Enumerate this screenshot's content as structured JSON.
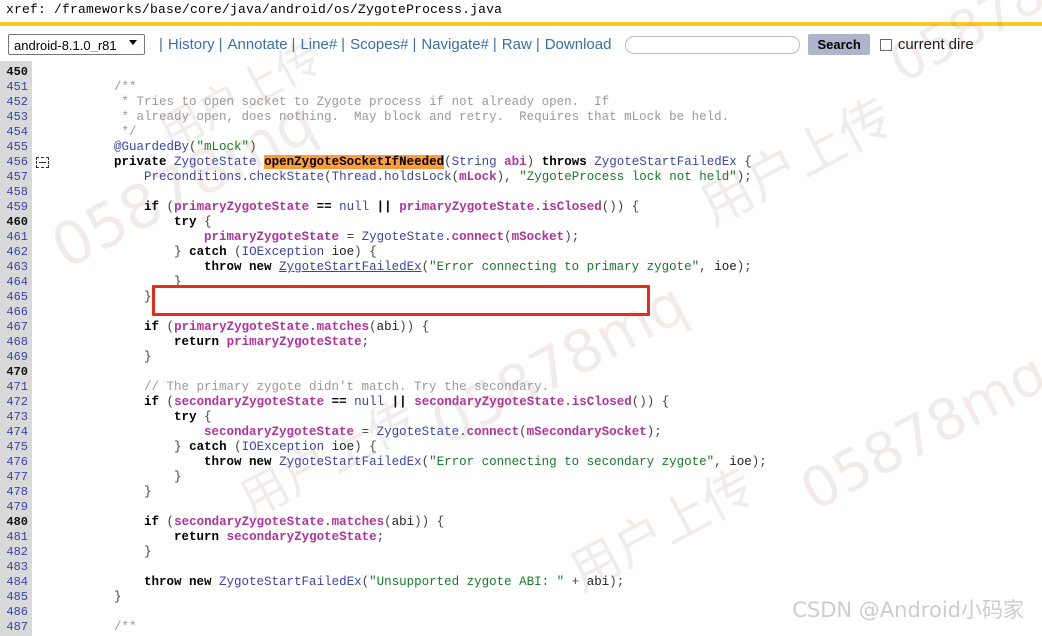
{
  "header": {
    "label": "xref:",
    "path": "/frameworks/base/core/java/android/os/ZygoteProcess.java",
    "full": "xref: /frameworks/base/core/java/android/os/ZygoteProcess.java",
    "accent_color": "#ffc627"
  },
  "toolbar": {
    "version_selected": "android-8.1.0_r81",
    "version_options": [
      "android-8.1.0_r81"
    ],
    "separator": "|",
    "links": [
      {
        "label": "History",
        "name": "history"
      },
      {
        "label": "Annotate",
        "name": "annotate"
      },
      {
        "label": "Line#",
        "name": "line-number"
      },
      {
        "label": "Scopes#",
        "name": "scopes"
      },
      {
        "label": "Navigate#",
        "name": "navigate"
      },
      {
        "label": "Raw",
        "name": "raw"
      },
      {
        "label": "Download",
        "name": "download"
      }
    ],
    "search_value": "",
    "search_placeholder": "",
    "search_button_label": "Search",
    "current_directory_label": "current dire",
    "current_directory_checked": false,
    "link_color": "#3b6ea8",
    "search_button_bg": "#aeb4cc"
  },
  "code": {
    "first_line": 450,
    "last_line": 487,
    "gutter_bg": "#d9d9d9",
    "fold_marker_line": 456,
    "lines": [
      {
        "n": 450,
        "html": ""
      },
      {
        "n": 451,
        "html": "        <span class='cmt'>/**</span>"
      },
      {
        "n": 452,
        "html": "         <span class='cmt'>* Tries to open socket to Zygote process if not already open.  If</span>"
      },
      {
        "n": 453,
        "html": "         <span class='cmt'>* already open, does nothing.  May block and retry.  Requires that mLock be held.</span>"
      },
      {
        "n": 454,
        "html": "         <span class='cmt'>*/</span>"
      },
      {
        "n": 455,
        "html": "        <span class='annot'>@GuardedBy</span><span class='punct'>(</span><span class='str'>\"mLock\"</span><span class='punct'>)</span>"
      },
      {
        "n": 456,
        "html": "        <span class='kw'>private</span> <span class='typ'>ZygoteState</span> <span class='hl'>openZygoteSocketIfNeeded</span><span class='punct'>(</span><span class='typ'>String</span> <span class='var'>abi</span><span class='punct'>)</span> <span class='kw'>throws</span> <span class='typ'>ZygoteStartFailedEx</span> <span class='punct'>{</span>"
      },
      {
        "n": 457,
        "html": "            <span class='typ'>Preconditions</span><span class='punct'>.</span><span class='typ'>checkState</span><span class='punct'>(</span><span class='typ'>Thread</span><span class='punct'>.</span><span class='typ'>holdsLock</span><span class='punct'>(</span><span class='var'>mLock</span><span class='punct'>),</span> <span class='str'>\"ZygoteProcess lock not held\"</span><span class='punct'>);</span>"
      },
      {
        "n": 458,
        "html": ""
      },
      {
        "n": 459,
        "html": "            <span class='kw'>if</span> <span class='punct'>(</span><span class='var'>primaryZygoteState</span> <span class='kw'>==</span> <span class='num'>null</span> <span class='kw'>||</span> <span class='var'>primaryZygoteState</span><span class='punct'>.</span><span class='var'>isClosed</span><span class='punct'>())</span> <span class='punct'>{</span>"
      },
      {
        "n": 460,
        "html": "                <span class='kw'>try</span> <span class='punct'>{</span>"
      },
      {
        "n": 461,
        "html": "                    <span class='var'>primaryZygoteState</span> <span class='punct'>=</span> <span class='typ'>ZygoteState</span><span class='punct'>.</span><span class='mth'>connect</span><span class='punct'>(</span><span class='var'>mSocket</span><span class='punct'>);</span>"
      },
      {
        "n": 462,
        "html": "                <span class='punct'>}</span> <span class='kw'>catch</span> <span class='punct'>(</span><span class='typ'>IOException</span> <span class='plain'>ioe</span><span class='punct'>)</span> <span class='punct'>{</span>"
      },
      {
        "n": 463,
        "html": "                    <span class='kw'>throw new</span> <span class='typu'>ZygoteStartFailedEx</span><span class='punct'>(</span><span class='str'>\"Error connecting to primary zygote\"</span><span class='punct'>,</span> <span class='plain'>ioe</span><span class='punct'>);</span>"
      },
      {
        "n": 464,
        "html": "                <span class='punct'>}</span>"
      },
      {
        "n": 465,
        "html": "            <span class='punct'>}</span>"
      },
      {
        "n": 466,
        "html": ""
      },
      {
        "n": 467,
        "html": "            <span class='kw'>if</span> <span class='punct'>(</span><span class='var'>primaryZygoteState</span><span class='punct'>.</span><span class='mth'>matches</span><span class='punct'>(</span><span class='plain'>abi</span><span class='punct'>))</span> <span class='punct'>{</span>"
      },
      {
        "n": 468,
        "html": "                <span class='kw'>return</span> <span class='var'>primaryZygoteState</span><span class='punct'>;</span>"
      },
      {
        "n": 469,
        "html": "            <span class='punct'>}</span>"
      },
      {
        "n": 470,
        "html": ""
      },
      {
        "n": 471,
        "html": "            <span class='cmt'>// The primary zygote didn't match. Try the secondary.</span>"
      },
      {
        "n": 472,
        "html": "            <span class='kw'>if</span> <span class='punct'>(</span><span class='var'>secondaryZygoteState</span> <span class='kw'>==</span> <span class='num'>null</span> <span class='kw'>||</span> <span class='var'>secondaryZygoteState</span><span class='punct'>.</span><span class='var'>isClosed</span><span class='punct'>())</span> <span class='punct'>{</span>"
      },
      {
        "n": 473,
        "html": "                <span class='kw'>try</span> <span class='punct'>{</span>"
      },
      {
        "n": 474,
        "html": "                    <span class='var'>secondaryZygoteState</span> <span class='punct'>=</span> <span class='typ'>ZygoteState</span><span class='punct'>.</span><span class='mth'>connect</span><span class='punct'>(</span><span class='var'>mSecondarySocket</span><span class='punct'>);</span>"
      },
      {
        "n": 475,
        "html": "                <span class='punct'>}</span> <span class='kw'>catch</span> <span class='punct'>(</span><span class='typ'>IOException</span> <span class='plain'>ioe</span><span class='punct'>)</span> <span class='punct'>{</span>"
      },
      {
        "n": 476,
        "html": "                    <span class='kw'>throw new</span> <span class='typ'>ZygoteStartFailedEx</span><span class='punct'>(</span><span class='str'>\"Error connecting to secondary zygote\"</span><span class='punct'>,</span> <span class='plain'>ioe</span><span class='punct'>);</span>"
      },
      {
        "n": 477,
        "html": "                <span class='punct'>}</span>"
      },
      {
        "n": 478,
        "html": "            <span class='punct'>}</span>"
      },
      {
        "n": 479,
        "html": ""
      },
      {
        "n": 480,
        "html": "            <span class='kw'>if</span> <span class='punct'>(</span><span class='var'>secondaryZygoteState</span><span class='punct'>.</span><span class='mth'>matches</span><span class='punct'>(</span><span class='plain'>abi</span><span class='punct'>))</span> <span class='punct'>{</span>"
      },
      {
        "n": 481,
        "html": "                <span class='kw'>return</span> <span class='var'>secondaryZygoteState</span><span class='punct'>;</span>"
      },
      {
        "n": 482,
        "html": "            <span class='punct'>}</span>"
      },
      {
        "n": 483,
        "html": ""
      },
      {
        "n": 484,
        "html": "            <span class='kw'>throw new</span> <span class='typ'>ZygoteStartFailedEx</span><span class='punct'>(</span><span class='str'>\"Unsupported zygote ABI: \"</span> <span class='punct'>+</span> <span class='plain'>abi</span><span class='punct'>);</span>"
      },
      {
        "n": 485,
        "html": "        <span class='punct'>}</span>"
      },
      {
        "n": 486,
        "html": ""
      },
      {
        "n": 487,
        "html": "        <span class='cmt'>/**</span>"
      }
    ]
  },
  "annotation": {
    "red_box_color": "#e82c18",
    "red_box_target_line": 461
  },
  "watermarks": {
    "csdn": "CSDN @Android小码家",
    "bg_tiles": [
      "05878mq",
      "用户上传",
      "05878mq",
      "用户上传",
      "05878mq",
      "用户上传",
      "05878mq",
      "用户上传"
    ]
  }
}
